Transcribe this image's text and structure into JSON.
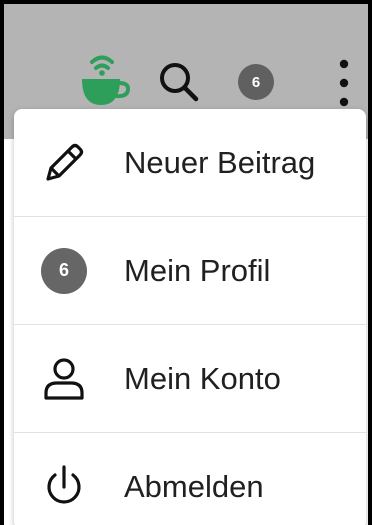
{
  "colors": {
    "topbar_bg": "#b4b4b4",
    "brand_green": "#2e9e5b",
    "avatar_bg": "#606060",
    "menu_text": "#202020"
  },
  "topbar": {
    "app_icon": "coffee-cup-icon",
    "search_icon": "search-icon",
    "avatar_text": "6",
    "more_icon": "more-vertical-icon"
  },
  "menu": {
    "items": [
      {
        "label": "Neuer Beitrag",
        "icon": "pencil-icon"
      },
      {
        "label": "Mein Profil",
        "icon": "avatar",
        "avatar_text": "6"
      },
      {
        "label": "Mein Konto",
        "icon": "user-icon"
      },
      {
        "label": "Abmelden",
        "icon": "power-icon"
      }
    ]
  }
}
